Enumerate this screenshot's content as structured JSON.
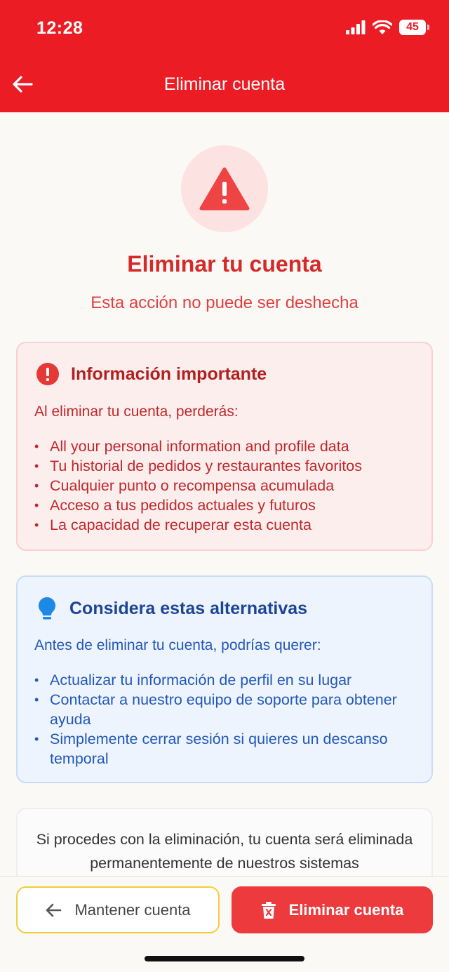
{
  "status": {
    "time": "12:28",
    "battery": "45"
  },
  "header": {
    "title": "Eliminar cuenta",
    "back_icon": "arrow-left-icon"
  },
  "hero": {
    "title": "Eliminar tu cuenta",
    "subtitle": "Esta acción no puede ser deshecha"
  },
  "important": {
    "title": "Información importante",
    "intro": "Al eliminar tu cuenta, perderás:",
    "items": [
      "All your personal information and profile data",
      "Tu historial de pedidos y restaurantes favoritos",
      "Cualquier punto o recompensa acumulada",
      "Acceso a tus pedidos actuales y futuros",
      "La capacidad de recuperar esta cuenta"
    ]
  },
  "alternatives": {
    "title": "Considera estas alternativas",
    "intro": "Antes de eliminar tu cuenta, podrías querer:",
    "items": [
      "Actualizar tu información de perfil en su lugar",
      "Contactar a nuestro equipo de soporte para obtener ayuda",
      "Simplemente cerrar sesión si quieres un descanso temporal"
    ]
  },
  "final": {
    "text": "Si procedes con la eliminación, tu cuenta será eliminada permanentemente de nuestros sistemas"
  },
  "buttons": {
    "keep_label": "Mantener cuenta",
    "delete_label": "Eliminar cuenta"
  },
  "colors": {
    "brand_red": "#ec1c24",
    "danger": "#ec3a3d",
    "info_blue": "#1d4597",
    "keep_border": "#f3cd3c"
  }
}
